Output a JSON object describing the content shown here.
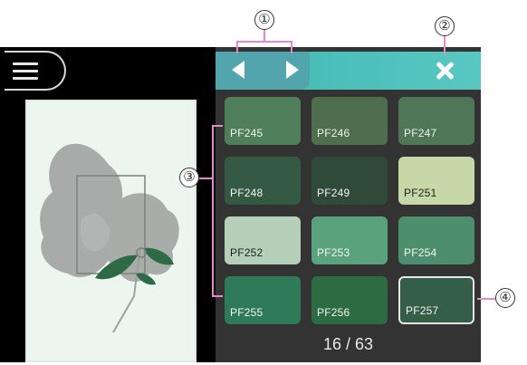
{
  "menu": {
    "icon": "hamburger-menu-icon"
  },
  "toolbar": {
    "prev_icon": "arrow-left-icon",
    "next_icon": "arrow-right-icon",
    "close_icon": "close-icon"
  },
  "colors": {
    "accent": "#4fc0bb",
    "panel": "#333333",
    "callout_line": "#e58ac8"
  },
  "swatches": [
    {
      "code": "PF245",
      "color": "#4f7f5a"
    },
    {
      "code": "PF246",
      "color": "#4e6e4e"
    },
    {
      "code": "PF247",
      "color": "#4f7657"
    },
    {
      "code": "PF248",
      "color": "#355a44"
    },
    {
      "code": "PF249",
      "color": "#2f4a39"
    },
    {
      "code": "PF251",
      "color": "#c6d8a8"
    },
    {
      "code": "PF252",
      "color": "#b6cfb8"
    },
    {
      "code": "PF253",
      "color": "#5aa27c"
    },
    {
      "code": "PF254",
      "color": "#4d8f6c"
    },
    {
      "code": "PF255",
      "color": "#2f7a58"
    },
    {
      "code": "PF256",
      "color": "#2d6b43"
    },
    {
      "code": "PF257",
      "color": "#355e47"
    }
  ],
  "pagination": {
    "text": "16 / 63"
  },
  "callouts": [
    "①",
    "②",
    "③",
    "④"
  ]
}
